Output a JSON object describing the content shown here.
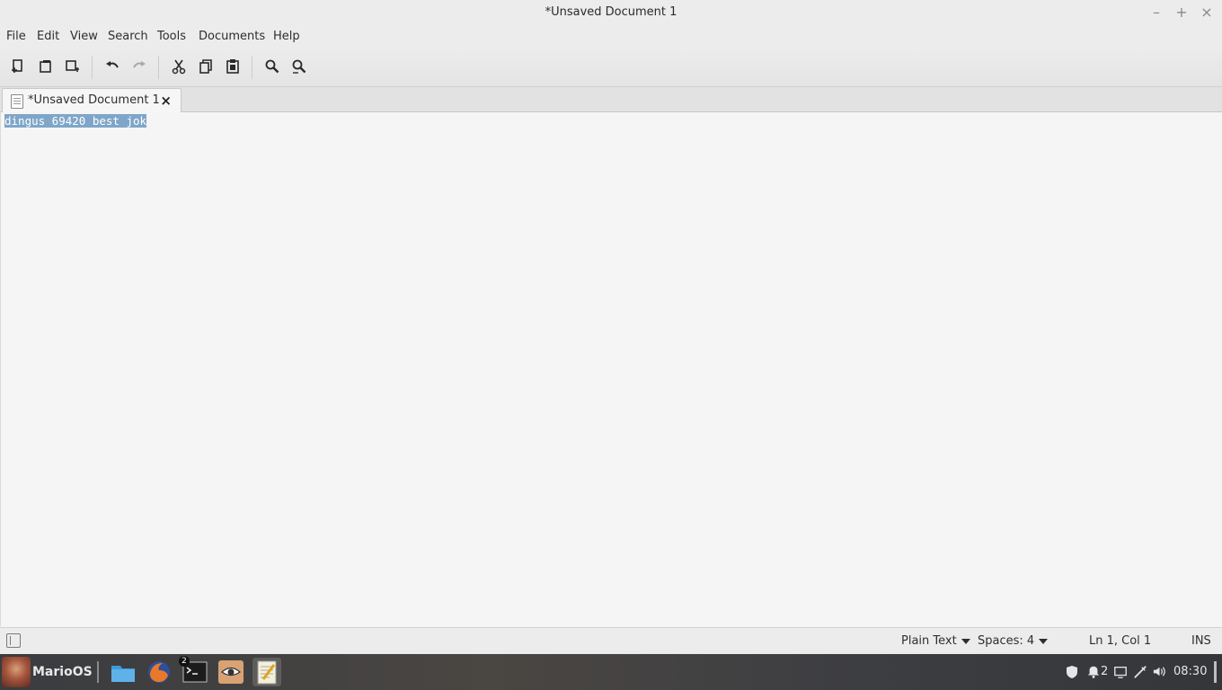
{
  "window": {
    "title": "*Unsaved Document 1",
    "controls": {
      "minimize": "–",
      "maximize": "+",
      "close": "×"
    }
  },
  "menubar": {
    "items": [
      "File",
      "Edit",
      "View",
      "Search",
      "Tools",
      "Documents",
      "Help"
    ]
  },
  "toolbar": {
    "buttons": [
      "new-document",
      "open-document",
      "save-document",
      "undo",
      "redo",
      "cut",
      "copy",
      "paste",
      "find",
      "find-replace"
    ]
  },
  "tabs": [
    {
      "label": "*Unsaved Document 1",
      "close": "×",
      "active": true
    }
  ],
  "editor": {
    "lines": [
      "dingus 69420 best jok"
    ],
    "selection": "dingus 69420 best jok",
    "selection_color": "#7fa6c9"
  },
  "statusbar": {
    "language": "Plain Text",
    "indent": "Spaces: 4",
    "position": "Ln 1, Col 1",
    "mode": "INS"
  },
  "taskbar": {
    "start_label": "MarioOS",
    "apps": [
      "file-manager",
      "firefox",
      "terminal",
      "eye-of-mate",
      "text-editor"
    ],
    "terminal_badge": "2",
    "tray": {
      "notifications_count": "2",
      "clock": "08:30"
    }
  }
}
